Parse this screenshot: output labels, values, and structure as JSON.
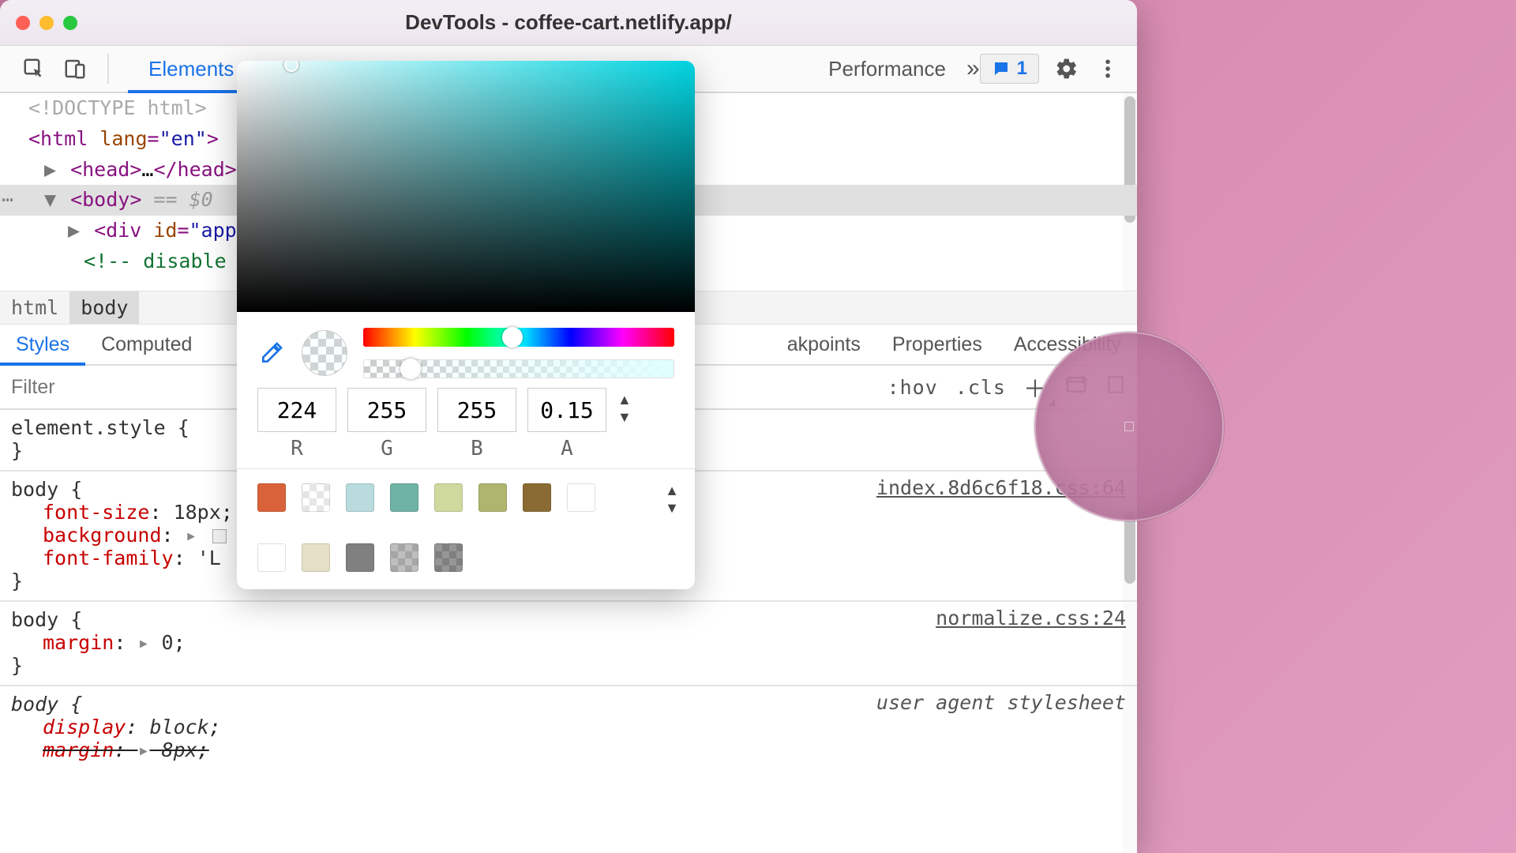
{
  "window": {
    "title": "DevTools - coffee-cart.netlify.app/"
  },
  "toolbar": {
    "tabs": {
      "elements": "Elements",
      "performance": "Performance"
    },
    "issue_count": "1"
  },
  "dom": {
    "line1": "<!DOCTYPE html>",
    "html_open_pre": "<html ",
    "html_lang_attr": "lang",
    "html_lang_val": "\"en\"",
    "html_open_post": ">",
    "head_open": "<head>",
    "head_ellipsis": "…",
    "head_close": "</head>",
    "body_open": "<body>",
    "body_aux": " == $0",
    "div_open_pre": "<div ",
    "div_id_attr": "id",
    "div_id_val": "\"app\"",
    "comment_pre": "<!-- disable",
    "comment_tail": ">"
  },
  "breadcrumb": {
    "html": "html",
    "body": "body"
  },
  "subtabs": {
    "styles": "Styles",
    "computed": "Computed",
    "breakpoints": "akpoints",
    "properties": "Properties",
    "accessibility": "Accessibility"
  },
  "filter": {
    "placeholder": "Filter",
    "hov": ":hov",
    "cls": ".cls"
  },
  "rules": {
    "element_style_sel": "element.style {",
    "close": "}",
    "r1": {
      "sel": "body {",
      "source": "index.8d6c6f18.css:64",
      "p1_name": "font-size",
      "p1_val": "18px",
      "p2_name": "background",
      "p3_name": "font-family",
      "p3_val": "'L"
    },
    "r2": {
      "sel": "body {",
      "source": "normalize.css:24",
      "p1_name": "margin",
      "p1_val": "0"
    },
    "r3": {
      "sel": "body {",
      "source": "user agent stylesheet",
      "p1_name": "display",
      "p1_val": "block",
      "p2_name": "margin",
      "p2_val": "8px"
    }
  },
  "picker": {
    "r": "224",
    "g": "255",
    "b": "255",
    "a": "0.15",
    "lbl_r": "R",
    "lbl_g": "G",
    "lbl_b": "B",
    "lbl_a": "A",
    "swatches": [
      "#d9623a",
      "checker:rgba(255,255,255,0.5)",
      "#b9dbdd",
      "#6fb2a6",
      "#cfd99e",
      "#b0b56e",
      "#8a6b33",
      "#ffffff",
      "#ffffff",
      "#e6e1c6",
      "#808080",
      "checker:rgba(128,128,128,0.5)",
      "checker:rgba(64,64,64,0.55)"
    ]
  }
}
